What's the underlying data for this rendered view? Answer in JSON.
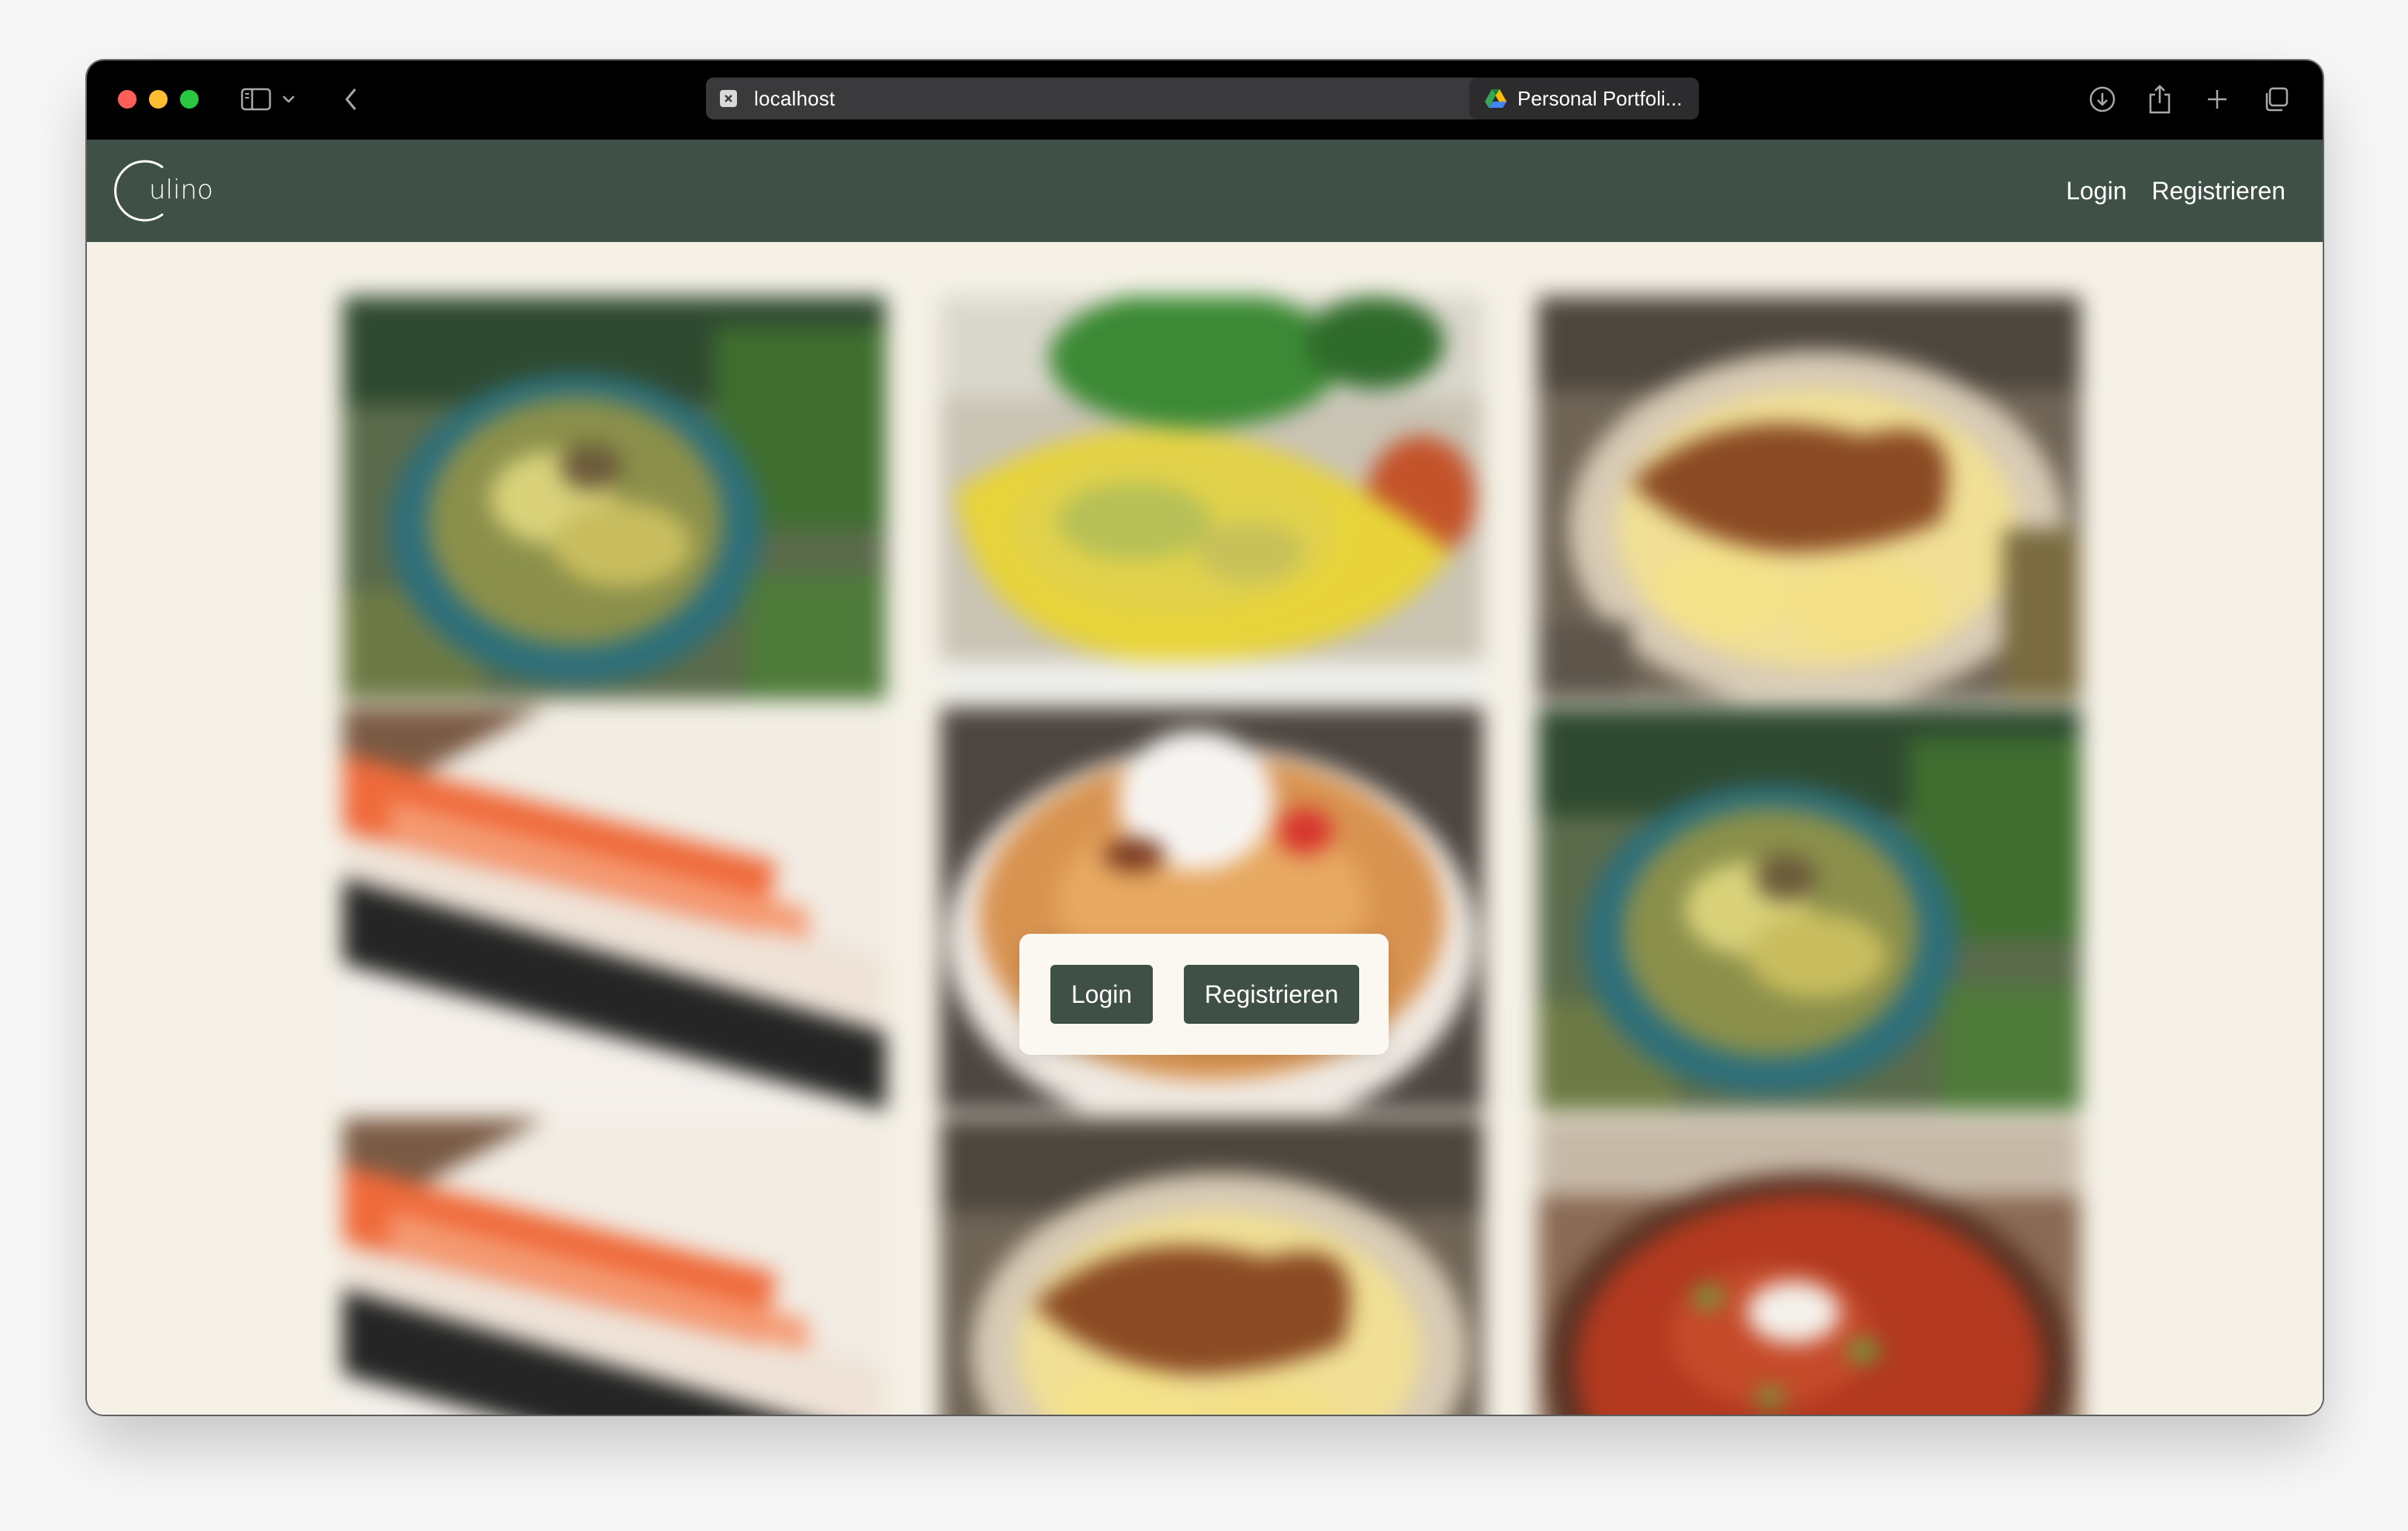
{
  "browser": {
    "address": "localhost",
    "tab_title": "Personal Portfoli...",
    "icons": [
      "sidebar-toggle-icon",
      "chevron-down-icon",
      "back-arrow-icon",
      "more-icon",
      "download-icon",
      "share-icon",
      "plus-icon",
      "tabs-overview-icon"
    ]
  },
  "site": {
    "logo_text": "ulino",
    "nav": {
      "login_label": "Login",
      "register_label": "Registrieren"
    },
    "colors": {
      "nav_background": "#3f5147",
      "page_background": "#f5f1e6",
      "button_background": "#3f5147"
    }
  },
  "gallery": {
    "blurred": true,
    "tiles": [
      {
        "name": "pasta-bowl-dish"
      },
      {
        "name": "omelette-dish"
      },
      {
        "name": "baked-casserole-dish"
      },
      {
        "name": "sushi-rolls-dish"
      },
      {
        "name": "pancake-cream-dish"
      },
      {
        "name": "pasta-bowl-dish"
      },
      {
        "name": "sushi-rolls-dish"
      },
      {
        "name": "baked-casserole-dish"
      },
      {
        "name": "tomato-stew-dish"
      }
    ]
  },
  "auth_overlay": {
    "login_label": "Login",
    "register_label": "Registrieren"
  }
}
